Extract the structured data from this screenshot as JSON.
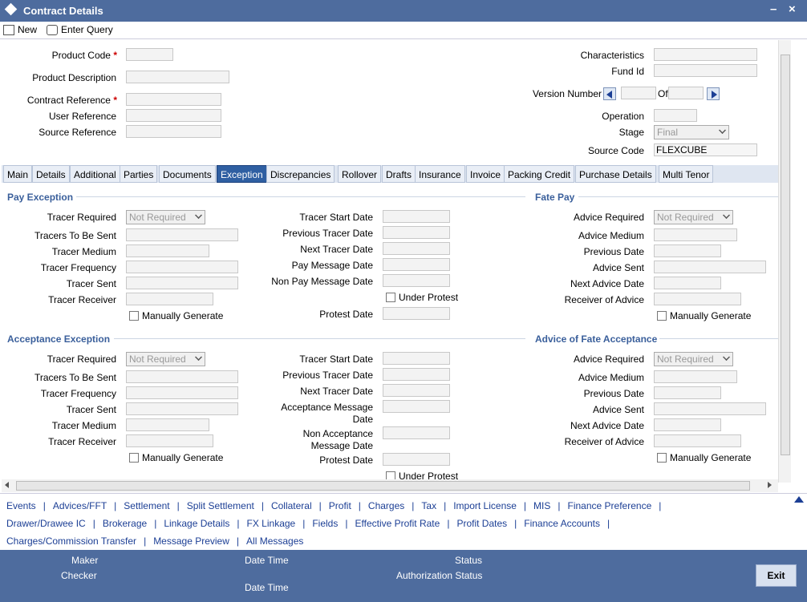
{
  "window": {
    "title": "Contract Details",
    "minimize": "–",
    "close": "×"
  },
  "toolbar": {
    "new": "New",
    "enter_query": "Enter Query"
  },
  "header_left": {
    "product_code": "Product Code",
    "product_description": "Product Description",
    "contract_reference": "Contract Reference",
    "user_reference": "User Reference",
    "source_reference": "Source Reference",
    "required_mark": "*"
  },
  "header_right": {
    "characteristics": "Characteristics",
    "fund_id": "Fund Id",
    "version_number": "Version Number",
    "of": "Of",
    "operation": "Operation",
    "stage": "Stage",
    "stage_value": "Final",
    "source_code": "Source Code",
    "source_code_value": "FLEXCUBE"
  },
  "tabs": [
    "Main",
    "Details",
    "Additional",
    "Parties",
    "Documents",
    "Exception",
    "Discrepancies",
    "Rollover",
    "Drafts",
    "Insurance",
    "Invoice",
    "Packing Credit",
    "Purchase Details",
    "Multi Tenor"
  ],
  "pay_exception": {
    "title": "Pay Exception",
    "left": [
      "Tracer Required",
      "Tracers To Be Sent",
      "Tracer Medium",
      "Tracer Frequency",
      "Tracer Sent",
      "Tracer Receiver"
    ],
    "tracer_required_value": "Not Required",
    "manual": "Manually Generate",
    "mid": [
      "Tracer Start Date",
      "Previous Tracer Date",
      "Next Tracer Date",
      "Pay Message Date",
      "Non Pay Message Date"
    ],
    "under_protest": "Under Protest",
    "protest_date": "Protest Date"
  },
  "fate_pay": {
    "title": "Fate Pay",
    "fields": [
      "Advice Required",
      "Advice Medium",
      "Previous Date",
      "Advice Sent",
      "Next Advice Date",
      "Receiver of Advice"
    ],
    "advice_required_value": "Not Required",
    "manual": "Manually Generate"
  },
  "acceptance_exception": {
    "title": "Acceptance Exception",
    "left": [
      "Tracer Required",
      "Tracers To Be Sent",
      "Tracer Frequency",
      "Tracer Sent",
      "Tracer Medium",
      "Tracer Receiver"
    ],
    "tracer_required_value": "Not Required",
    "manual": "Manually Generate",
    "mid": [
      "Tracer Start Date",
      "Previous Tracer Date",
      "Next Tracer Date"
    ],
    "acceptance_msg_1": "Acceptance Message",
    "acceptance_msg_2": "Date",
    "non_acceptance_1": "Non Acceptance",
    "non_acceptance_2": "Message Date",
    "protest_date": "Protest Date",
    "under_protest": "Under Protest"
  },
  "advice_fate_acceptance": {
    "title": "Advice of Fate Acceptance",
    "fields": [
      "Advice Required",
      "Advice Medium",
      "Previous Date",
      "Advice Sent",
      "Next Advice Date",
      "Receiver of Advice"
    ],
    "advice_required_value": "Not Required",
    "manual": "Manually Generate"
  },
  "links": {
    "row1": [
      "Events",
      "Advices/FFT",
      "Settlement",
      "Split Settlement",
      "Collateral",
      "Profit",
      "Charges",
      "Tax",
      "Import License",
      "MIS",
      "Finance Preference"
    ],
    "row2": [
      "Drawer/Drawee IC",
      "Brokerage",
      "Linkage Details",
      "FX Linkage",
      "Fields",
      "Effective Profit Rate",
      "Profit Dates",
      "Finance Accounts"
    ],
    "row3": [
      "Charges/Commission Transfer",
      "Message Preview",
      "All Messages"
    ],
    "separator": "|"
  },
  "footer": {
    "maker": "Maker",
    "checker": "Checker",
    "date_time": "Date Time",
    "status": "Status",
    "authorization_status": "Authorization Status",
    "exit": "Exit"
  },
  "colors": {
    "title_bar": "#4e6c9e",
    "active_tab": "#2f5fa2",
    "section_title": "#3a5f9b",
    "link": "#1c3f95"
  }
}
